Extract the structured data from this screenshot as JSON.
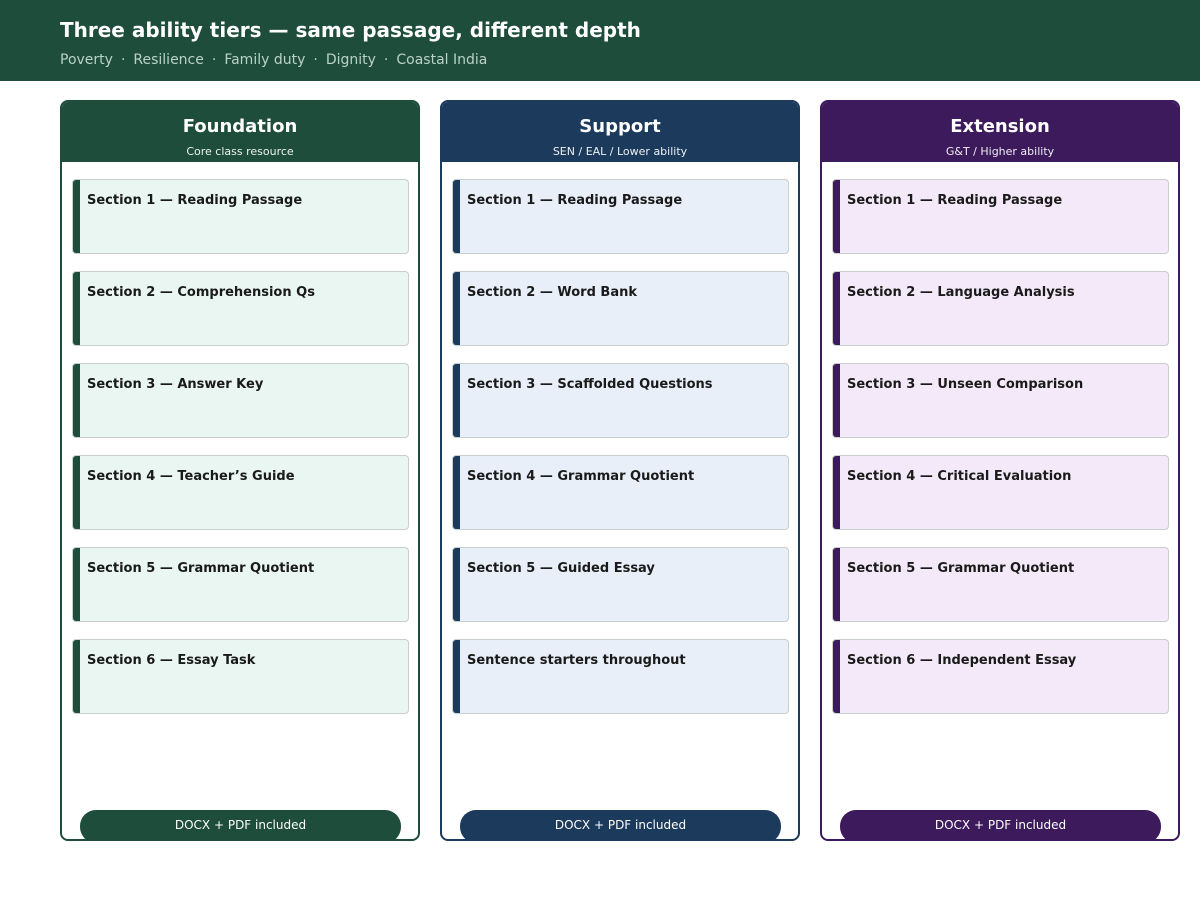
{
  "header": {
    "title": "Three ability tiers — same passage, different depth",
    "tags": [
      "Poverty",
      "Resilience",
      "Family duty",
      "Dignity",
      "Coastal India"
    ],
    "separator": "·"
  },
  "tiers": [
    {
      "title": "Foundation",
      "subtitle": "Core class resource",
      "accent": "#1e4d3c",
      "section_bg": "#e9f6f1",
      "sections": [
        "Section 1 — Reading Passage",
        "Section 2 — Comprehension Qs",
        "Section 3 — Answer Key",
        "Section 4 — Teacher’s Guide",
        "Section 5 — Grammar Quotient",
        "Section 6 — Essay Task"
      ],
      "badge": "DOCX + PDF included"
    },
    {
      "title": "Support",
      "subtitle": "SEN / EAL / Lower ability",
      "accent": "#1b3a5c",
      "section_bg": "#e8eff9",
      "sections": [
        "Section 1 — Reading Passage",
        "Section 2 — Word Bank",
        "Section 3 — Scaffolded Questions",
        "Section 4 — Grammar Quotient",
        "Section 5 — Guided Essay",
        "Sentence starters throughout"
      ],
      "badge": "DOCX + PDF included"
    },
    {
      "title": "Extension",
      "subtitle": "G&T / Higher ability",
      "accent": "#3c1a5b",
      "section_bg": "#f3e9f8",
      "sections": [
        "Section 1 — Reading Passage",
        "Section 2 — Language Analysis",
        "Section 3 — Unseen Comparison",
        "Section 4 — Critical Evaluation",
        "Section 5 — Grammar Quotient",
        "Section 6 — Independent Essay"
      ],
      "badge": "DOCX + PDF included"
    }
  ]
}
